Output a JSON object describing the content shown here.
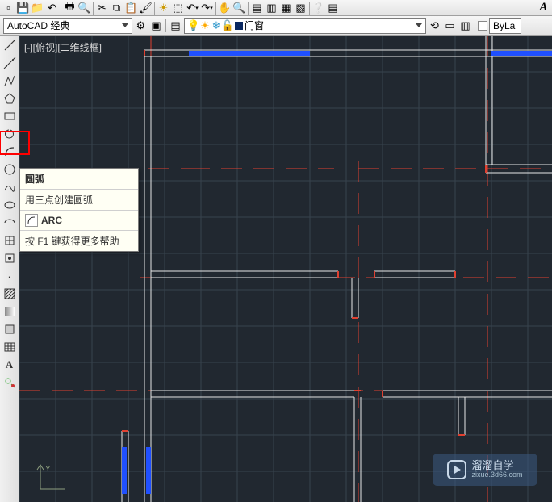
{
  "workspace_combo": "AutoCAD 经典",
  "layer_combo_prefix": "",
  "layer_combo": "门窗",
  "bylayer_combo": "ByLa",
  "view_label": "[-][俯视][二维线框]",
  "tooltip": {
    "title": "圆弧",
    "desc": "用三点创建圆弧",
    "cmd": "ARC",
    "f1": "按 F1 键获得更多帮助"
  },
  "watermark": {
    "title": "溜溜自学",
    "sub": "zixue.3d66.com"
  },
  "top_icons": [
    "new",
    "save",
    "disk",
    "undo",
    "plot",
    "zoom",
    "extend",
    "cut",
    "copy",
    "paste",
    "match",
    "paint",
    "clip",
    "undo2",
    "redo",
    "pan",
    "zoom2",
    "props",
    "sheet",
    "table",
    "blk",
    "help",
    "help2",
    "text"
  ],
  "layer_icons": [
    "bulb",
    "sun",
    "grid",
    "lock",
    "blk"
  ]
}
